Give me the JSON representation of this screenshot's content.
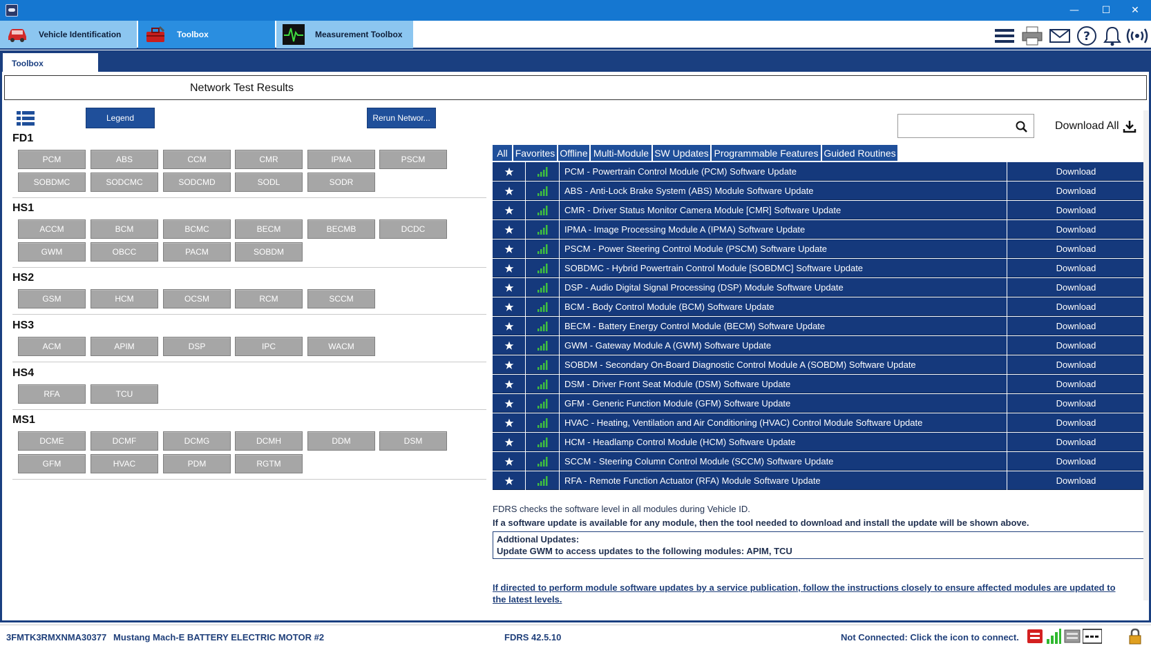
{
  "window": {
    "minimize_glyph": "—",
    "maximize_glyph": "☐",
    "close_glyph": "✕"
  },
  "top_tabs": [
    {
      "label": "Vehicle Identification",
      "icon": "car-icon"
    },
    {
      "label": "Toolbox",
      "icon": "toolbox-icon"
    },
    {
      "label": "Measurement Toolbox",
      "icon": "oscilloscope-icon"
    }
  ],
  "toolbar_icons": [
    "menu-icon",
    "printer-icon",
    "mail-icon",
    "help-icon",
    "bell-icon",
    "wireless-icon"
  ],
  "subtab": {
    "label": "Toolbox"
  },
  "page": {
    "title": "Network Test Results"
  },
  "left": {
    "legend_label": "Legend",
    "rerun_label": "Rerun Networ...",
    "networks": [
      {
        "name": "FD1",
        "rows": [
          [
            "PCM",
            "ABS",
            "CCM",
            "CMR",
            "IPMA",
            "PSCM"
          ],
          [
            "SOBDMC",
            "SODCMC",
            "SODCMD",
            "SODL",
            "SODR"
          ]
        ]
      },
      {
        "name": "HS1",
        "rows": [
          [
            "ACCM",
            "BCM",
            "BCMC",
            "BECM",
            "BECMB",
            "DCDC"
          ],
          [
            "GWM",
            "OBCC",
            "PACM",
            "SOBDM"
          ]
        ]
      },
      {
        "name": "HS2",
        "rows": [
          [
            "GSM",
            "HCM",
            "OCSM",
            "RCM",
            "SCCM"
          ]
        ]
      },
      {
        "name": "HS3",
        "rows": [
          [
            "ACM",
            "APIM",
            "DSP",
            "IPC",
            "WACM"
          ]
        ]
      },
      {
        "name": "HS4",
        "rows": [
          [
            "RFA",
            "TCU"
          ]
        ]
      },
      {
        "name": "MS1",
        "rows": [
          [
            "DCME",
            "DCMF",
            "DCMG",
            "DCMH",
            "DDM",
            "DSM"
          ],
          [
            "GFM",
            "HVAC",
            "PDM",
            "RGTM"
          ]
        ]
      }
    ]
  },
  "right": {
    "search": {
      "placeholder": "",
      "value": ""
    },
    "download_all_label": "Download All",
    "filter_tabs": [
      "All",
      "Favorites",
      "Offline",
      "Multi-Module",
      "SW Updates",
      "Programmable Features",
      "Guided Routines"
    ],
    "updates": [
      {
        "desc": "PCM - Powertrain Control Module (PCM) Software Update",
        "action": "Download"
      },
      {
        "desc": "ABS - Anti-Lock Brake System (ABS) Module Software Update",
        "action": "Download"
      },
      {
        "desc": "CMR - Driver Status Monitor Camera Module [CMR] Software Update",
        "action": "Download"
      },
      {
        "desc": "IPMA - Image Processing Module A (IPMA) Software Update",
        "action": "Download"
      },
      {
        "desc": "PSCM - Power Steering Control Module (PSCM) Software Update",
        "action": "Download"
      },
      {
        "desc": "SOBDMC - Hybrid Powertrain Control Module [SOBDMC] Software Update",
        "action": "Download"
      },
      {
        "desc": "DSP - Audio Digital Signal Processing (DSP) Module Software Update",
        "action": "Download"
      },
      {
        "desc": "BCM - Body Control Module (BCM) Software Update",
        "action": "Download"
      },
      {
        "desc": "BECM - Battery Energy Control Module (BECM) Software Update",
        "action": "Download"
      },
      {
        "desc": "GWM - Gateway Module A (GWM) Software Update",
        "action": "Download"
      },
      {
        "desc": "SOBDM - Secondary On-Board Diagnostic Control Module A (SOBDM) Software Update",
        "action": "Download"
      },
      {
        "desc": "DSM - Driver Front Seat Module (DSM) Software Update",
        "action": "Download"
      },
      {
        "desc": "GFM - Generic Function Module (GFM) Software Update",
        "action": "Download"
      },
      {
        "desc": "HVAC - Heating, Ventilation and Air Conditioning (HVAC) Control Module Software Update",
        "action": "Download"
      },
      {
        "desc": "HCM - Headlamp Control Module (HCM) Software Update",
        "action": "Download"
      },
      {
        "desc": "SCCM - Steering Column Control Module (SCCM) Software Update",
        "action": "Download"
      },
      {
        "desc": "RFA - Remote Function Actuator (RFA) Module Software Update",
        "action": "Download"
      }
    ],
    "info_line1": "FDRS checks the software level in all modules during Vehicle ID.",
    "info_line2": "If a software update is available for any module, then the tool needed to download and install the update will be shown above.",
    "additional_title": "Addtional Updates:",
    "additional_text": "Update GWM to access updates to the following modules: APIM, TCU",
    "directive": "If directed to perform module software updates by a service publication, follow the instructions closely to ensure affected modules are updated to the latest levels."
  },
  "status": {
    "vin": "3FMTK3RMXNMA30377",
    "vehicle": "Mustang Mach-E BATTERY ELECTRIC MOTOR #2",
    "version": "FDRS 42.5.10",
    "connection": "Not Connected: Click the icon to connect."
  },
  "colors": {
    "title_bar": "#1577d1",
    "nav_dark": "#1a3f80",
    "table_row": "#15397c",
    "module_button": "#a6a6a6",
    "signal_green": "#3fbf3f"
  }
}
